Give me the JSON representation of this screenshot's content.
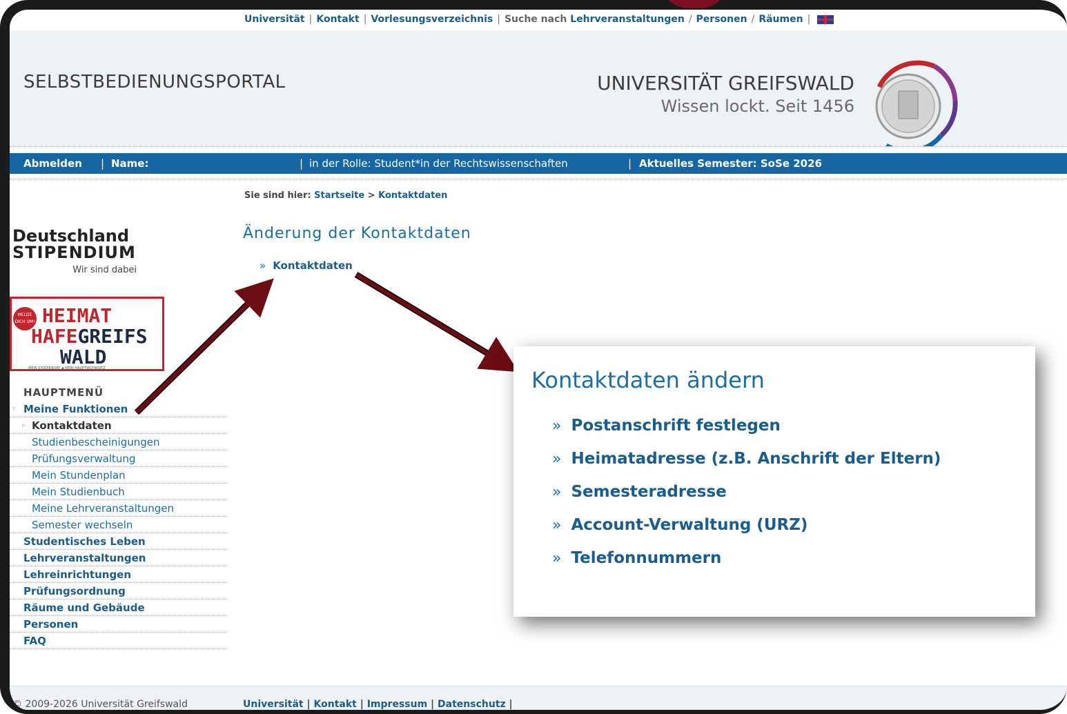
{
  "topnav": {
    "universitaet": "Universität",
    "kontakt": "Kontakt",
    "vorlesungsverzeichnis": "Vorlesungsverzeichnis",
    "suche_prefix": "Suche nach",
    "lehrveranstaltungen": "Lehrveranstaltungen",
    "personen": "Personen",
    "raeumen": "Räumen"
  },
  "header": {
    "portal_title": "SELBSTBEDIENUNGSPORTAL",
    "uni_name": "UNIVERSITÄT GREIFSWALD",
    "uni_tagline": "Wissen lockt. Seit 1456"
  },
  "userbar": {
    "logout": "Abmelden",
    "name_label": "Name:",
    "role": "in der Rolle: Student*in der Rechtswissenschaften",
    "semester": "Aktuelles Semester: SoSe 2026"
  },
  "breadcrumb": {
    "prefix": "Sie sind hier:",
    "home": "Startseite",
    "current": "Kontaktdaten"
  },
  "main": {
    "title": "Änderung der Kontaktdaten",
    "link": "Kontaktdaten"
  },
  "sidebar": {
    "ds_line1": "Deutschland",
    "ds_line2": "STIPENDIUM",
    "ds_line3": "Wir sind dabei",
    "heimat_badge": "MELDE DICH UM!",
    "heimat_l1": "HEIMAT",
    "heimat_l2a": "HAFE",
    "heimat_l2b": "GREIFS",
    "heimat_l3": "WALD",
    "heimat_small": "MEIN STUDIENORT ▪ MEIN HAUPTWOHNSITZ",
    "menu_head": "HAUPTMENÜ",
    "items": [
      {
        "label": "Meine Funktionen",
        "kind": "top"
      },
      {
        "label": "Kontaktdaten",
        "kind": "active"
      },
      {
        "label": "Studienbescheinigungen",
        "kind": "sub"
      },
      {
        "label": "Prüfungsverwaltung",
        "kind": "sub"
      },
      {
        "label": "Mein Stundenplan",
        "kind": "sub"
      },
      {
        "label": "Mein Studienbuch",
        "kind": "sub"
      },
      {
        "label": "Meine Lehrveranstaltungen",
        "kind": "sub"
      },
      {
        "label": "Semester wechseln",
        "kind": "sub"
      },
      {
        "label": "Studentisches Leben",
        "kind": "top"
      },
      {
        "label": "Lehrveranstaltungen",
        "kind": "top"
      },
      {
        "label": "Lehreinrichtungen",
        "kind": "top"
      },
      {
        "label": "Prüfungsordnung",
        "kind": "top"
      },
      {
        "label": "Räume und Gebäude",
        "kind": "top"
      },
      {
        "label": "Personen",
        "kind": "top"
      },
      {
        "label": "FAQ",
        "kind": "top"
      }
    ]
  },
  "zoom_panel": {
    "title": "Kontaktdaten ändern",
    "links": [
      "Postanschrift festlegen",
      "Heimatadresse (z.B. Anschrift der Eltern)",
      "Semesteradresse",
      "Account-Verwaltung (URZ)",
      "Telefonnummern"
    ]
  },
  "footer": {
    "copyright": "© 2009-2026 Universität Greifswald",
    "links": [
      "Universität",
      "Kontakt",
      "Impressum",
      "Datenschutz"
    ]
  },
  "colors": {
    "brand_blue": "#1566a2",
    "link_blue": "#1a5d8c",
    "arrow": "#6b0d12",
    "accent_red": "#c0272d"
  }
}
